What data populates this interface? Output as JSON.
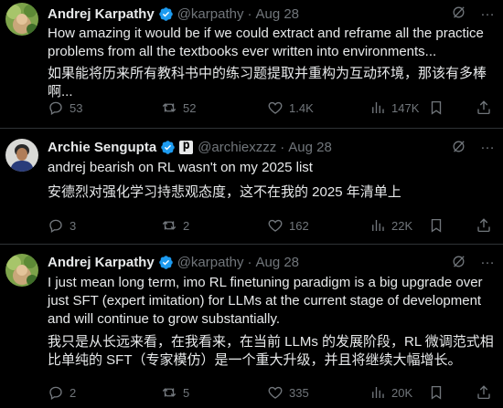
{
  "colors": {
    "background": "#000000",
    "text": "#e7e9ea",
    "muted": "#71767b",
    "verified": "#1d9bf0",
    "divider": "#2f3336"
  },
  "tweets": [
    {
      "name": "Andrej Karpathy",
      "handle": "@karpathy",
      "separator": "·",
      "date": "Aug 28",
      "more": "…",
      "text_en": "How amazing it would be if we could extract and reframe all the practice problems from all the textbooks ever written into environments...",
      "text_zh": "如果能将历来所有教科书中的练习题提取并重构为互动环境，那该有多棒啊...",
      "stats": {
        "replies": "53",
        "reposts": "52",
        "likes": "1.4K",
        "views": "147K"
      }
    },
    {
      "name": "Archie Sengupta",
      "handle": "@archiexzzz",
      "separator": "·",
      "date": "Aug 28",
      "more": "…",
      "badge": "p",
      "text_en": "andrej bearish on RL wasn't on my 2025 list",
      "text_zh": "安德烈对强化学习持悲观态度，这不在我的 2025 年清单上",
      "stats": {
        "replies": "3",
        "reposts": "2",
        "likes": "162",
        "views": "22K"
      }
    },
    {
      "name": "Andrej Karpathy",
      "handle": "@karpathy",
      "separator": "·",
      "date": "Aug 28",
      "more": "…",
      "text_en": "I just mean long term, imo RL finetuning paradigm is a big upgrade over just SFT (expert imitation) for LLMs at the current stage of development and will continue to grow substantially.",
      "text_zh": "我只是从长远来看，在我看来，在当前 LLMs 的发展阶段，RL 微调范式相比单纯的 SFT（专家模仿）是一个重大升级，并且将继续大幅增长。",
      "stats": {
        "replies": "2",
        "reposts": "5",
        "likes": "335",
        "views": "20K"
      }
    }
  ]
}
